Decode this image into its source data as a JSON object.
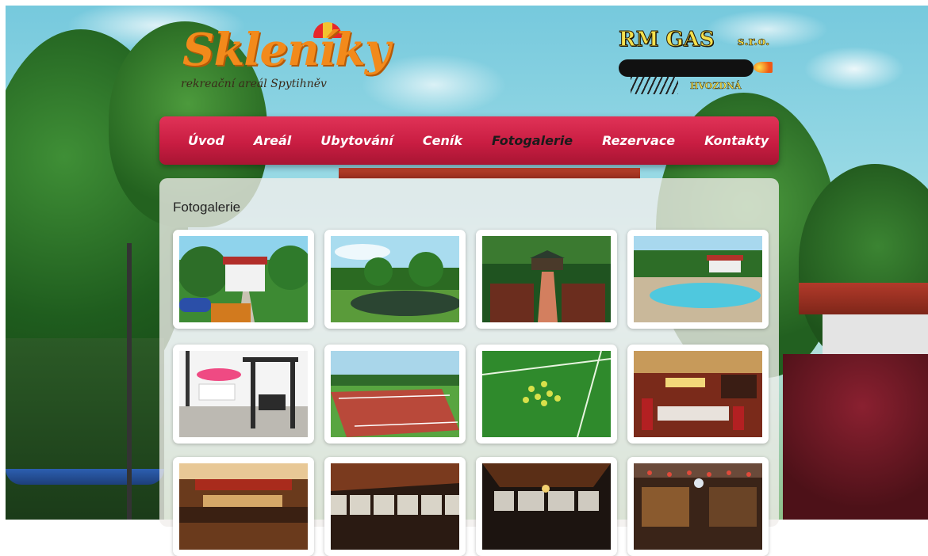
{
  "header": {
    "logo_left": {
      "title": "Skleníky",
      "subtitle": "rekreační areál Spytihněv"
    },
    "logo_right": {
      "brand": "RM GAS",
      "suffix": "s.r.o.",
      "town": "HVOZDNÁ"
    }
  },
  "nav": {
    "items": [
      {
        "label": "Úvod",
        "active": false
      },
      {
        "label": "Areál",
        "active": false
      },
      {
        "label": "Ubytování",
        "active": false
      },
      {
        "label": "Ceník",
        "active": false
      },
      {
        "label": "Fotogalerie",
        "active": true
      },
      {
        "label": "Rezervace",
        "active": false
      },
      {
        "label": "Kontakty",
        "active": false
      }
    ]
  },
  "gallery": {
    "title": "Fotogalerie",
    "photos": [
      "house-garden",
      "pond",
      "bridge-gazebo",
      "swimming-pool",
      "garden-swing",
      "tennis-court",
      "green-balls",
      "restaurant-interior",
      "hall-interior-1",
      "hall-interior-2",
      "hall-interior-3",
      "bar-interior"
    ]
  },
  "colors": {
    "nav_red": "#c91d42",
    "nav_active_text": "#1b1b1b",
    "logo_orange": "#f28a1b",
    "logo_yellow": "#f4e04d"
  }
}
